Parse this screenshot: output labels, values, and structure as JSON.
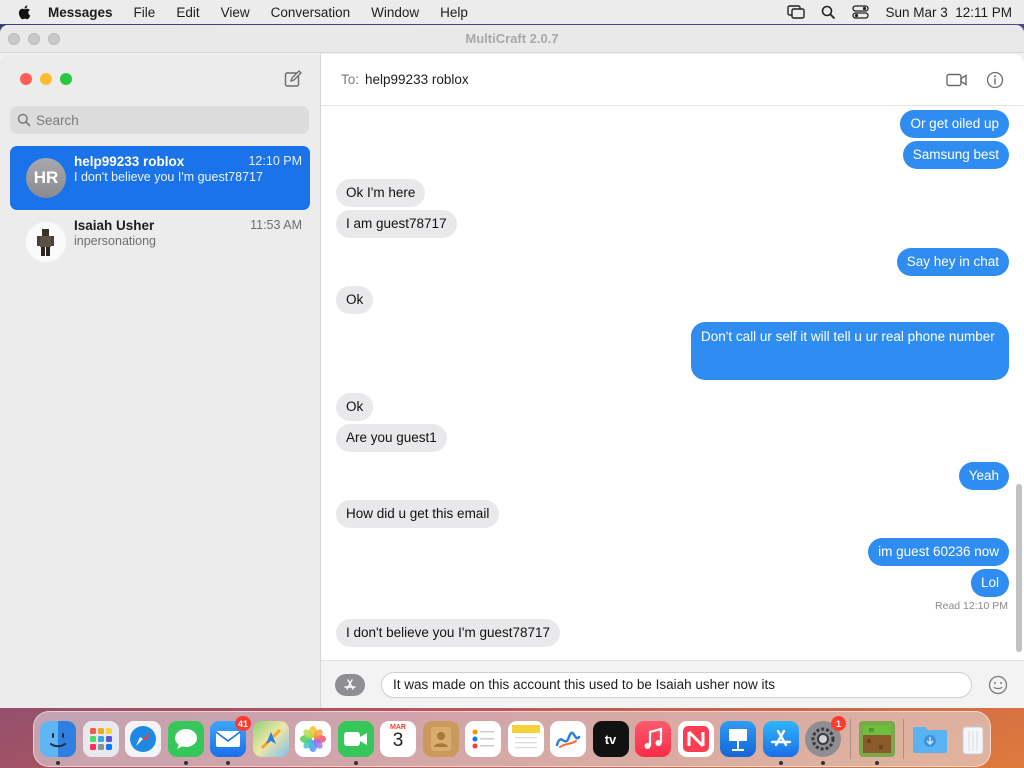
{
  "menubar": {
    "app_name": "Messages",
    "items": [
      "File",
      "Edit",
      "View",
      "Conversation",
      "Window",
      "Help"
    ],
    "clock": "Sun Mar 3  12:11 PM"
  },
  "outer_window": {
    "title": "MultiCraft 2.0.7"
  },
  "sidebar": {
    "search_placeholder": "Search",
    "conversations": [
      {
        "initials": "HR",
        "name": "help99233 roblox",
        "time": "12:10 PM",
        "preview": "I don't believe you I'm guest78717",
        "active": true
      },
      {
        "name": "Isaiah Usher",
        "time": "11:53 AM",
        "preview": "inpersonationg",
        "active": false
      }
    ]
  },
  "chat": {
    "to_label": "To:",
    "recipient": "help99233 roblox",
    "messages": [
      {
        "dir": "out",
        "text": "Or get oiled up"
      },
      {
        "dir": "out",
        "text": "Samsung best"
      },
      {
        "dir": "in",
        "text": "Ok I'm here"
      },
      {
        "dir": "in",
        "text": "I am guest78717"
      },
      {
        "dir": "out",
        "text": "Say hey in chat"
      },
      {
        "dir": "in",
        "text": "Ok"
      },
      {
        "dir": "out",
        "text": "Don't call ur self it will tell u ur real phone number"
      },
      {
        "dir": "in",
        "text": "Ok"
      },
      {
        "dir": "in",
        "text": "Are you guest1"
      },
      {
        "dir": "out",
        "text": "Yeah"
      },
      {
        "dir": "in",
        "text": "How did u get this email"
      },
      {
        "dir": "out",
        "text": "im guest 60236 now"
      },
      {
        "dir": "out",
        "text": "Lol"
      },
      {
        "dir": "in",
        "text": "I don't believe you I'm guest78717"
      }
    ],
    "read_receipt": "Read 12:10 PM",
    "composer_text": "It was made on this account this used to be Isaiah usher now its"
  },
  "dock": {
    "icons": [
      {
        "name": "finder-icon",
        "running": true
      },
      {
        "name": "launchpad-icon"
      },
      {
        "name": "safari-icon"
      },
      {
        "name": "messages-icon",
        "running": true
      },
      {
        "name": "mail-icon",
        "badge": "41",
        "running": true
      },
      {
        "name": "maps-icon"
      },
      {
        "name": "photos-icon"
      },
      {
        "name": "facetime-icon",
        "running": true
      },
      {
        "name": "calendar-icon",
        "month": "MAR",
        "day": "3"
      },
      {
        "name": "contacts-icon"
      },
      {
        "name": "reminders-icon"
      },
      {
        "name": "notes-icon"
      },
      {
        "name": "freeform-icon"
      },
      {
        "name": "apple-tv-icon",
        "label": "tv"
      },
      {
        "name": "music-icon"
      },
      {
        "name": "news-icon"
      },
      {
        "name": "keynote-icon"
      },
      {
        "name": "app-store-icon",
        "running": true
      },
      {
        "name": "system-settings-icon",
        "badge": "1",
        "running": true
      },
      {
        "name": "multicraft-icon",
        "running": true
      },
      {
        "name": "downloads-folder-icon"
      },
      {
        "name": "trash-icon"
      }
    ]
  },
  "colors": {
    "accent": "#1a73e8",
    "bubble_out": "#2f8cf0",
    "bubble_in": "#e9e9eb",
    "traffic_red": "#ff5f57",
    "traffic_yellow": "#febc2e",
    "traffic_green": "#28c840"
  }
}
